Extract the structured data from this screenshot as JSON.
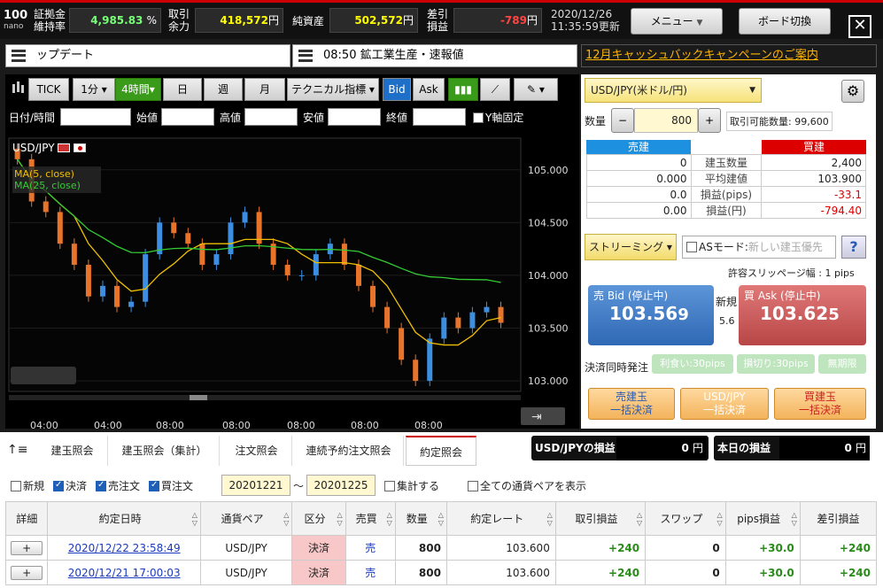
{
  "header": {
    "logo_top": "100",
    "logo_bottom": "nano",
    "margin_label_1": "証拠金",
    "margin_label_2": "維持率",
    "margin_value": "4,985.83",
    "margin_unit": "%",
    "avail_label_1": "取引",
    "avail_label_2": "余力",
    "avail_value": "418,572",
    "avail_unit": "円",
    "net_label": "純資産",
    "net_value": "502,572",
    "net_unit": "円",
    "diff_label_1": "差引",
    "diff_label_2": "損益",
    "diff_value": "-789",
    "diff_unit": "円",
    "date": "2020/12/26",
    "time": "11:35:59更新",
    "menu_label": "メニュー",
    "board_label": "ボード切換"
  },
  "ticker": {
    "news1": "ップデート",
    "news2": "08:50 鉱工業生産・速報値",
    "campaign": "12月キャッシュバックキャンペーンのご案内"
  },
  "chart_toolbar": {
    "tick": "TICK",
    "1m": "1分",
    "4h": "4時間",
    "day": "日",
    "week": "週",
    "month": "月",
    "tech": "テクニカル指標",
    "bid": "Bid",
    "ask": "Ask"
  },
  "chart_fields": {
    "datetime": "日付/時間",
    "open": "始値",
    "high": "高値",
    "low": "安値",
    "close": "終値",
    "yfix": "Y軸固定"
  },
  "chart_data": {
    "type": "candlestick",
    "symbol": "USD/JPY",
    "legend": [
      "MA(5, close)",
      "MA(25, close)"
    ],
    "yticks": [
      "105.000",
      "104.500",
      "104.000",
      "103.500",
      "103.000"
    ],
    "xticks": [
      "04:00",
      "04:00",
      "08:00",
      "08:00",
      "08:00",
      "08:00",
      "08:00"
    ],
    "ylim": [
      102.9,
      105.3
    ],
    "close": [
      105.1,
      104.7,
      104.6,
      104.3,
      104.1,
      103.8,
      103.9,
      103.7,
      103.75,
      104.2,
      104.5,
      104.4,
      104.3,
      104.1,
      104.2,
      104.5,
      104.6,
      104.3,
      104.1,
      104.0,
      104.0,
      104.2,
      104.3,
      104.1,
      103.9,
      103.7,
      103.5,
      103.2,
      103.0,
      103.4,
      103.6,
      103.5,
      103.65,
      103.7,
      103.55
    ]
  },
  "order": {
    "pair": "USD/JPY(米ドル/円)",
    "qty_label": "数量",
    "qty": "800",
    "avail_label": "取引可能数量: 99,600",
    "sell_head": "売建",
    "buy_head": "買建",
    "rows": [
      {
        "s": "0",
        "l": "建玉数量",
        "b": "2,400"
      },
      {
        "s": "0.000",
        "l": "平均建値",
        "b": "103.900"
      },
      {
        "s": "0.0",
        "l": "損益(pips)",
        "b": "-33.1"
      },
      {
        "s": "0.00",
        "l": "損益(円)",
        "b": "-794.40"
      }
    ],
    "streaming": "ストリーミング",
    "as_mode": "ASモード:",
    "as_placeholder": "新しい建玉優先",
    "slippage": "許容スリッページ幅 : 1 pips",
    "bid_label": "売 Bid (停止中)",
    "bid_main": "103.56",
    "bid_last": "9",
    "new_label": "新規",
    "spread": "5.6",
    "ask_label": "買 Ask (停止中)",
    "ask_main": "103.62",
    "ask_last": "5",
    "settle_label": "決済同時発注",
    "take": "利食い:30pips",
    "stop": "損切り:30pips",
    "unlimited": "無期限",
    "sell_all_1": "売建玉",
    "sell_all_2": "一括決済",
    "pair_all_1": "USD/JPY",
    "pair_all_2": "一括決済",
    "buy_all_1": "買建玉",
    "buy_all_2": "一括決済"
  },
  "tabs": [
    "建玉照会",
    "建玉照会（集計）",
    "注文照会",
    "連続予約注文照会",
    "約定照会"
  ],
  "pl": {
    "pair_label": "USD/JPYの損益",
    "pair_value": "0",
    "day_label": "本日の損益",
    "day_value": "0",
    "unit": "円"
  },
  "filters": {
    "new": "新規",
    "settle": "決済",
    "sell": "売注文",
    "buy": "買注文",
    "from": "20201221",
    "tilde": "〜",
    "to": "20201225",
    "agg": "集計する",
    "allpairs": "全ての通貨ペアを表示"
  },
  "table": {
    "headers": [
      "詳細",
      "約定日時",
      "通貨ペア",
      "区分",
      "売買",
      "数量",
      "約定レート",
      "取引損益",
      "スワップ",
      "pips損益",
      "差引損益"
    ],
    "rows": [
      {
        "plus": "+",
        "dt": "2020/12/22 23:58:49",
        "pair": "USD/JPY",
        "kind": "決済",
        "side": "売",
        "qty": "800",
        "rate": "103.600",
        "pl": "+240",
        "swap": "0",
        "pips": "+30.0",
        "net": "+240"
      },
      {
        "plus": "+",
        "dt": "2020/12/21 17:00:03",
        "pair": "USD/JPY",
        "kind": "決済",
        "side": "売",
        "qty": "800",
        "rate": "103.600",
        "pl": "+240",
        "swap": "0",
        "pips": "+30.0",
        "net": "+240"
      }
    ]
  },
  "colors": {
    "accent": "#cc0000",
    "bid": "#3a76c4",
    "ask": "#c95050",
    "green": "#3a9a1a"
  }
}
